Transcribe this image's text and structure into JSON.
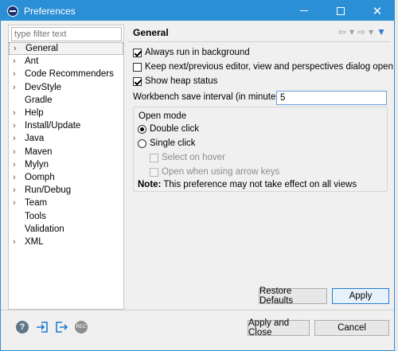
{
  "window": {
    "title": "Preferences"
  },
  "filter": {
    "placeholder": "type filter text"
  },
  "tree": [
    {
      "label": "General",
      "expandable": true
    },
    {
      "label": "Ant",
      "expandable": true
    },
    {
      "label": "Code Recommenders",
      "expandable": true
    },
    {
      "label": "DevStyle",
      "expandable": true
    },
    {
      "label": "Gradle",
      "expandable": false
    },
    {
      "label": "Help",
      "expandable": true
    },
    {
      "label": "Install/Update",
      "expandable": true
    },
    {
      "label": "Java",
      "expandable": true
    },
    {
      "label": "Maven",
      "expandable": true
    },
    {
      "label": "Mylyn",
      "expandable": true
    },
    {
      "label": "Oomph",
      "expandable": true
    },
    {
      "label": "Run/Debug",
      "expandable": true
    },
    {
      "label": "Team",
      "expandable": true
    },
    {
      "label": "Tools",
      "expandable": false
    },
    {
      "label": "Validation",
      "expandable": false
    },
    {
      "label": "XML",
      "expandable": true
    }
  ],
  "page": {
    "title": "General",
    "always_run_bg": "Always run in background",
    "keep_next_prev": "Keep next/previous editor, view and perspectives dialog open",
    "show_heap": "Show heap status",
    "interval_label": "Workbench save interval (in minutes):",
    "interval_value": "5",
    "open_mode": {
      "title": "Open mode",
      "double_click": "Double click",
      "single_click": "Single click",
      "select_on_hover": "Select on hover",
      "open_arrow_keys": "Open when using arrow keys"
    },
    "note_label": "Note:",
    "note_text": " This preference may not take effect on all views"
  },
  "buttons": {
    "restore_defaults": "Restore Defaults",
    "apply": "Apply",
    "apply_close": "Apply and Close",
    "cancel": "Cancel"
  },
  "icons": {
    "help": "?",
    "rec": "REC"
  }
}
